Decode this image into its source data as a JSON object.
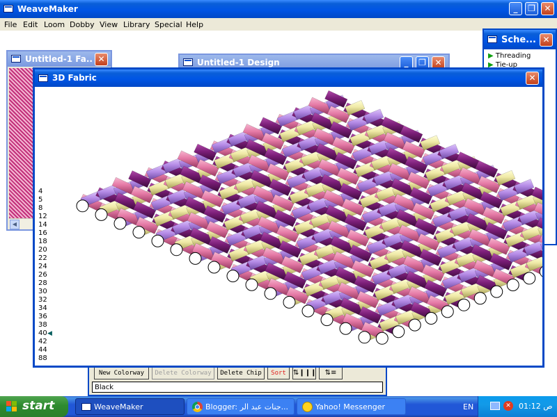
{
  "app": {
    "title": "WeaveMaker",
    "menu": [
      "File",
      "Edit",
      "Loom",
      "Dobby",
      "View",
      "Library",
      "Special",
      "Help"
    ]
  },
  "windows": {
    "fabric": {
      "title": "Untitled-1 Fa..."
    },
    "design": {
      "title": "Untitled-1 Design"
    },
    "schemes": {
      "title": "Sche...",
      "items": [
        "Threading",
        "Tie-up"
      ]
    },
    "fabric3d": {
      "title": "3D Fabric",
      "thread_numbers": [
        "4",
        "5",
        "8",
        "12",
        "14",
        "16",
        "18",
        "20",
        "22",
        "24",
        "26",
        "28",
        "30",
        "32",
        "34",
        "36",
        "38",
        "40",
        "42",
        "44",
        "88"
      ],
      "selected_thread": "40"
    },
    "colorways": {
      "buttons": {
        "new": "New Colorway",
        "delete": "Delete Colorway",
        "delete_chip": "Delete Chip",
        "sort": "Sort"
      },
      "name_value": "Black"
    }
  },
  "colors": {
    "xp_blue": "#0054e3",
    "warp_pink": "#e57aa6",
    "warp_purple": "#7b1e78",
    "weft_lavender": "#b58be6",
    "weft_cream": "#efe9a6",
    "sort_red": "#e02020"
  },
  "taskbar": {
    "start": "start",
    "items": [
      {
        "label": "WeaveMaker",
        "icon": "window-icon"
      },
      {
        "label": "Blogger: جنات عبد الر...",
        "icon": "chrome-icon"
      },
      {
        "label": "Yahoo! Messenger",
        "icon": "yahoo-smiley-icon"
      }
    ],
    "lang": "EN",
    "clock": "01:12 ص"
  }
}
